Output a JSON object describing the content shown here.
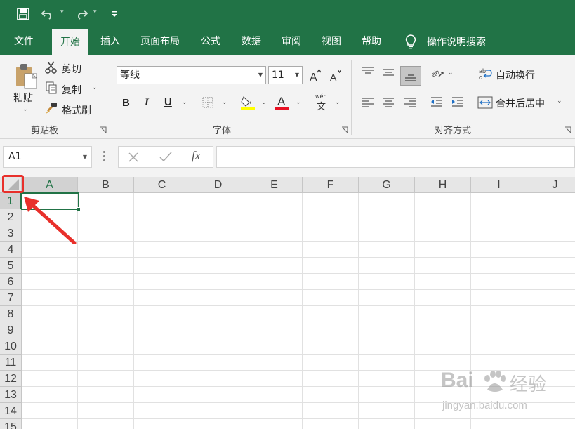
{
  "colors": {
    "brand_green": "#217346",
    "annotation_red": "#e8302b"
  },
  "quick_access": {
    "icons": [
      "save-icon",
      "undo-icon",
      "redo-icon",
      "customize-qat-icon"
    ]
  },
  "ribbon_tabs": [
    "文件",
    "开始",
    "插入",
    "页面布局",
    "公式",
    "数据",
    "审阅",
    "视图",
    "帮助"
  ],
  "active_tab": "开始",
  "tell_me": "操作说明搜索",
  "clipboard": {
    "paste": "粘贴",
    "cut": "剪切",
    "copy": "复制",
    "format_painter": "格式刷",
    "label": "剪贴板"
  },
  "font": {
    "name": "等线",
    "size": "11",
    "label": "字体",
    "bold": "B",
    "italic": "I",
    "underline": "U",
    "font_color_letter": "A",
    "phonetic_top": "wén",
    "phonetic_bottom": "文"
  },
  "alignment": {
    "wrap_text": "自动换行",
    "merge_center": "合并后居中",
    "label": "对齐方式"
  },
  "formula_bar": {
    "name_box": "A1",
    "fx": "fx",
    "value": ""
  },
  "grid": {
    "columns": [
      "A",
      "B",
      "C",
      "D",
      "E",
      "F",
      "G",
      "H",
      "I",
      "J"
    ],
    "rows": [
      "1",
      "2",
      "3",
      "4",
      "5",
      "6",
      "7",
      "8",
      "9",
      "10",
      "11",
      "12",
      "13",
      "14",
      "15"
    ],
    "selected_cell": "A1"
  },
  "watermark": {
    "brand": "Bai",
    "brand_cn": "经验",
    "url": "jingyan.baidu.com"
  }
}
